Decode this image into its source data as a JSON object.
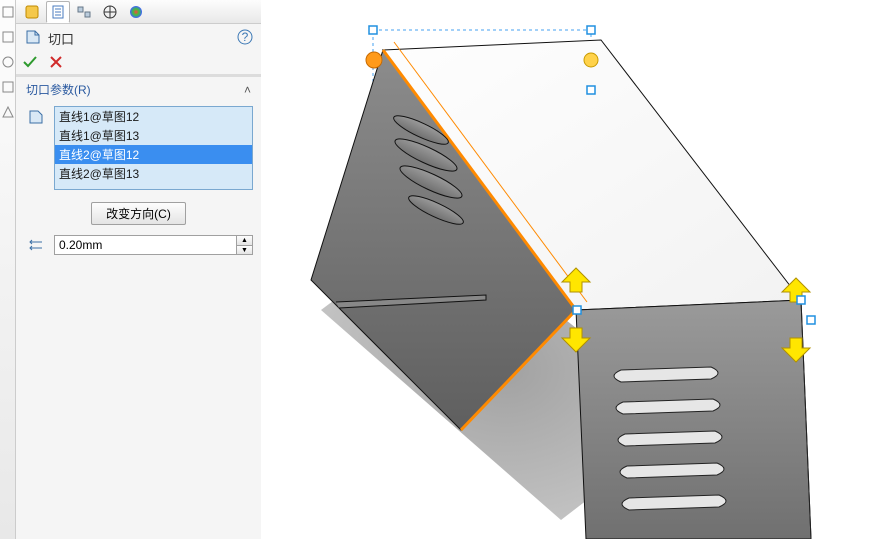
{
  "header": {
    "title": "切口"
  },
  "section": {
    "title": "切口参数(R)"
  },
  "list": {
    "items": [
      {
        "label": "直线1@草图12",
        "selected": false
      },
      {
        "label": "直线1@草图13",
        "selected": false
      },
      {
        "label": "直线2@草图12",
        "selected": true
      },
      {
        "label": "直线2@草图13",
        "selected": false
      }
    ]
  },
  "buttons": {
    "change_dir": "改变方向(C)"
  },
  "value": {
    "thickness": "0.20mm"
  },
  "icons": {
    "feature": "⬚",
    "help": "?",
    "ok": "✔",
    "cancel": "✖",
    "chevron": "˄"
  }
}
